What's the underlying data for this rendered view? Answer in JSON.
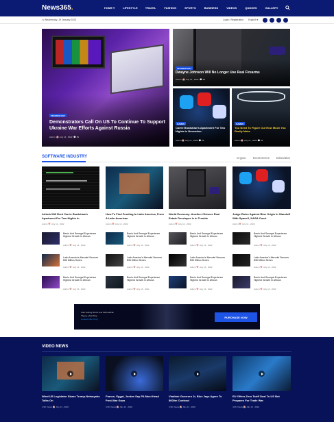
{
  "header": {
    "logo": "News365",
    "logo_dot": ".",
    "menu": [
      "HOME ▾",
      "LIFESTYLE",
      "TRAVEL",
      "FASHION",
      "SPORTS",
      "BUSINESS",
      "VIDEOS",
      "QUIZZES",
      "GALLERY"
    ]
  },
  "topbar": {
    "date": "Wednesday, 19 January 2023",
    "login": "Login / Registration",
    "language": "English ▾"
  },
  "hero": {
    "main": {
      "badge": "TECHNOLOGY",
      "title": "Demonstrators Call On US To Continue To Support Ukraine War Efforts Against Russia",
      "author": "Admin",
      "date": "July 14 , 2022",
      "comments": "29"
    },
    "top_right": {
      "badge": "TECHNOLOGY",
      "title": "Dwayne Johnson Will No Longer Use Real Firearms",
      "author": "Admin",
      "date": "July 14 , 2022",
      "comments": "35"
    },
    "bottom_left": {
      "badge": "GAMES",
      "title": "Carrie Bradshaw's Apartment For Two Nights In November.",
      "author": "Admin",
      "date": "July 14 , 2022",
      "comments": "29"
    },
    "bottom_right": {
      "badge": "GAMES",
      "title": "You Need To Figure Out How Much You Really Make",
      "author": "Admin",
      "date": "July 14 , 2022",
      "comments": "29"
    }
  },
  "software": {
    "title": "SOFTWARE INDUSTRY",
    "tabs": [
      "Crypto",
      "Ecommerce",
      "Education"
    ],
    "columns": [
      {
        "title": "Airbnb Will Rent Carrie Bradshaw's Apartment For Two Nights In",
        "author": "Admin",
        "date": "July 14 , 2022"
      },
      {
        "title": "How To Find Funding In Latin America, From A Latin American",
        "author": "Admin",
        "date": "July 14 , 2022"
      },
      {
        "title": "World Economy: Another Chinese Real Estate Developer Is In Trouble",
        "author": "Admin",
        "date": "July 14 , 2022"
      },
      {
        "title": "Judge Rules Against Blue Origin In Standoff With SpaceX, NASA Court",
        "author": "Admin",
        "date": "July 14 , 2022"
      }
    ],
    "rows": [
      {
        "title": "Benin And Senegal Experience Highest Growth In African",
        "author": "Admin",
        "date": "July 14 , 2022"
      },
      {
        "title": "Latin America's Merodel Secures $35 Million Series",
        "author": "Admin",
        "date": "July 14 , 2022"
      },
      {
        "title": "Benin And Senegal Experience Highest Growth In African",
        "author": "Admin",
        "date": "July 14 , 2022"
      }
    ]
  },
  "ad": {
    "line1": "Start Selling BLOG and MAGAZINE",
    "line2": "Theme of All Time",
    "line3": "Limited Offer Only!",
    "button": "PURCHASE NOW"
  },
  "video_news": {
    "title": "VIDEO NEWS",
    "items": [
      {
        "title": "What US Legislator Slams Trump-Netanyahu Talks On",
        "views": "4.9K Views",
        "date": "July 14 , 2022"
      },
      {
        "title": "France, Egypt, Jordan Say PA Must Head Post-War Gaza",
        "views": "4.9K Views",
        "date": "July 14 , 2022"
      },
      {
        "title": "Vladimir Guerrero Jr, Blue Jays Agree To $000m Contract",
        "views": "4.9K Views",
        "date": "July 14 , 2022"
      },
      {
        "title": "EU Offers Zero Tariff Deal To US But Prepares For Trade War",
        "views": "4.9K Views",
        "date": "July 14 , 2022"
      }
    ]
  },
  "colors": {
    "nav": "#0b1a73",
    "accent": "#1e54e6",
    "video_bg": "#071258"
  }
}
